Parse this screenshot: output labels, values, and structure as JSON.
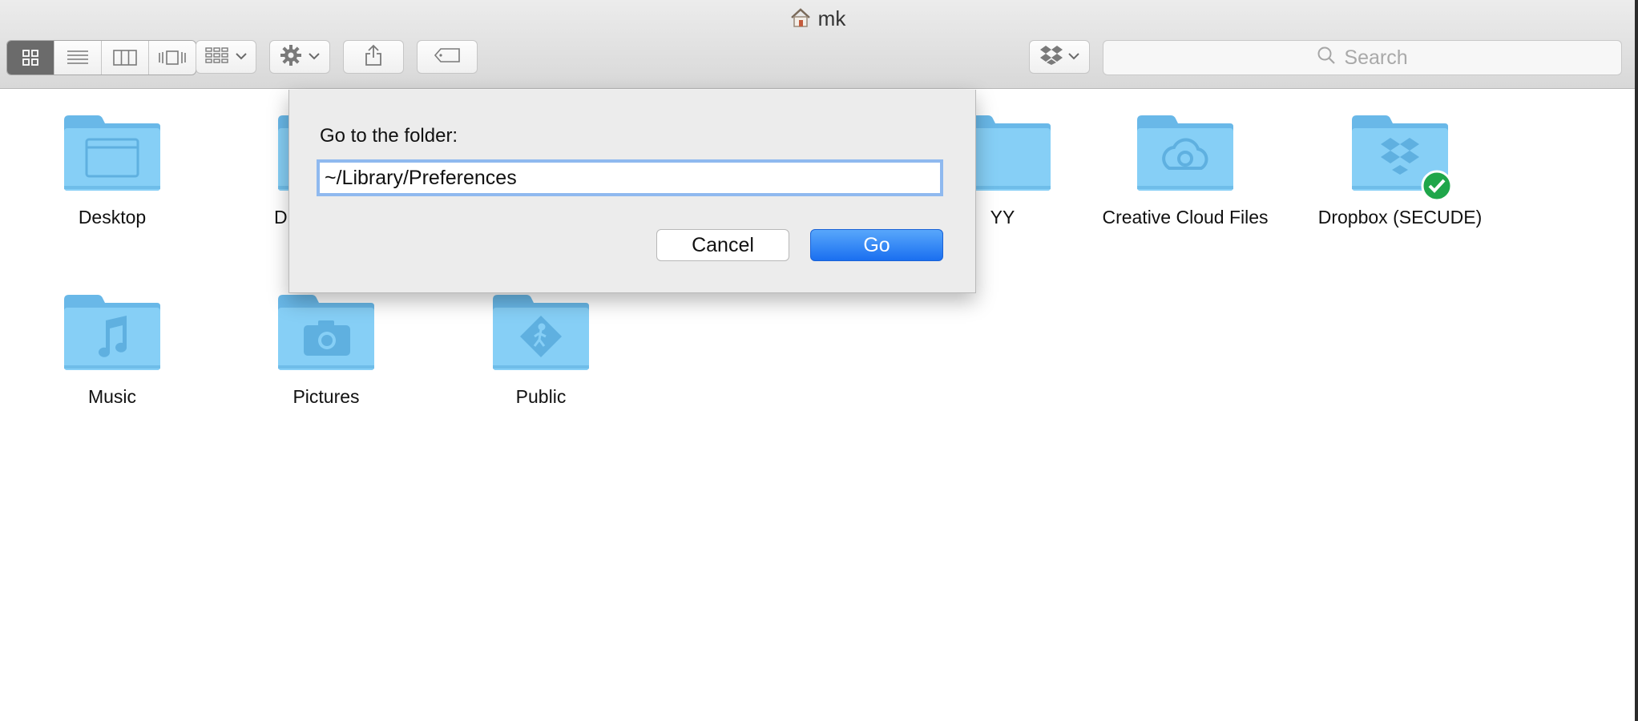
{
  "window": {
    "title": "mk"
  },
  "toolbar": {
    "view_buttons": [
      "icon-view-icon",
      "list-view-icon",
      "column-view-icon",
      "cover-flow-icon"
    ],
    "arrange_icon": "arrange-grid-icon",
    "action_icon": "gear-icon",
    "share_icon": "share-icon",
    "tag_icon": "tag-icon",
    "dropbox_icon": "dropbox-icon",
    "search_placeholder": "Search"
  },
  "folders": [
    {
      "label": "Desktop",
      "icon": "desktop-folder-icon"
    },
    {
      "label": "D",
      "icon": "documents-folder-icon"
    },
    {
      "label": "YY",
      "icon": "folder-icon"
    },
    {
      "label": "Creative Cloud Files",
      "icon": "creative-cloud-folder-icon"
    },
    {
      "label": "Dropbox (SECUDE)",
      "icon": "dropbox-folder-icon",
      "badge": "synced-check-icon"
    },
    {
      "label": "Music",
      "icon": "music-folder-icon"
    },
    {
      "label": "Pictures",
      "icon": "pictures-folder-icon"
    },
    {
      "label": "Public",
      "icon": "public-folder-icon"
    }
  ],
  "dialog": {
    "label": "Go to the folder:",
    "input_value": "~/Library/Preferences",
    "cancel_label": "Cancel",
    "go_label": "Go"
  },
  "colors": {
    "folder": "#7cc8f4",
    "folder_tab": "#6dbcea",
    "accent_blue": "#1a6ff0",
    "badge_green": "#1fa64a"
  }
}
